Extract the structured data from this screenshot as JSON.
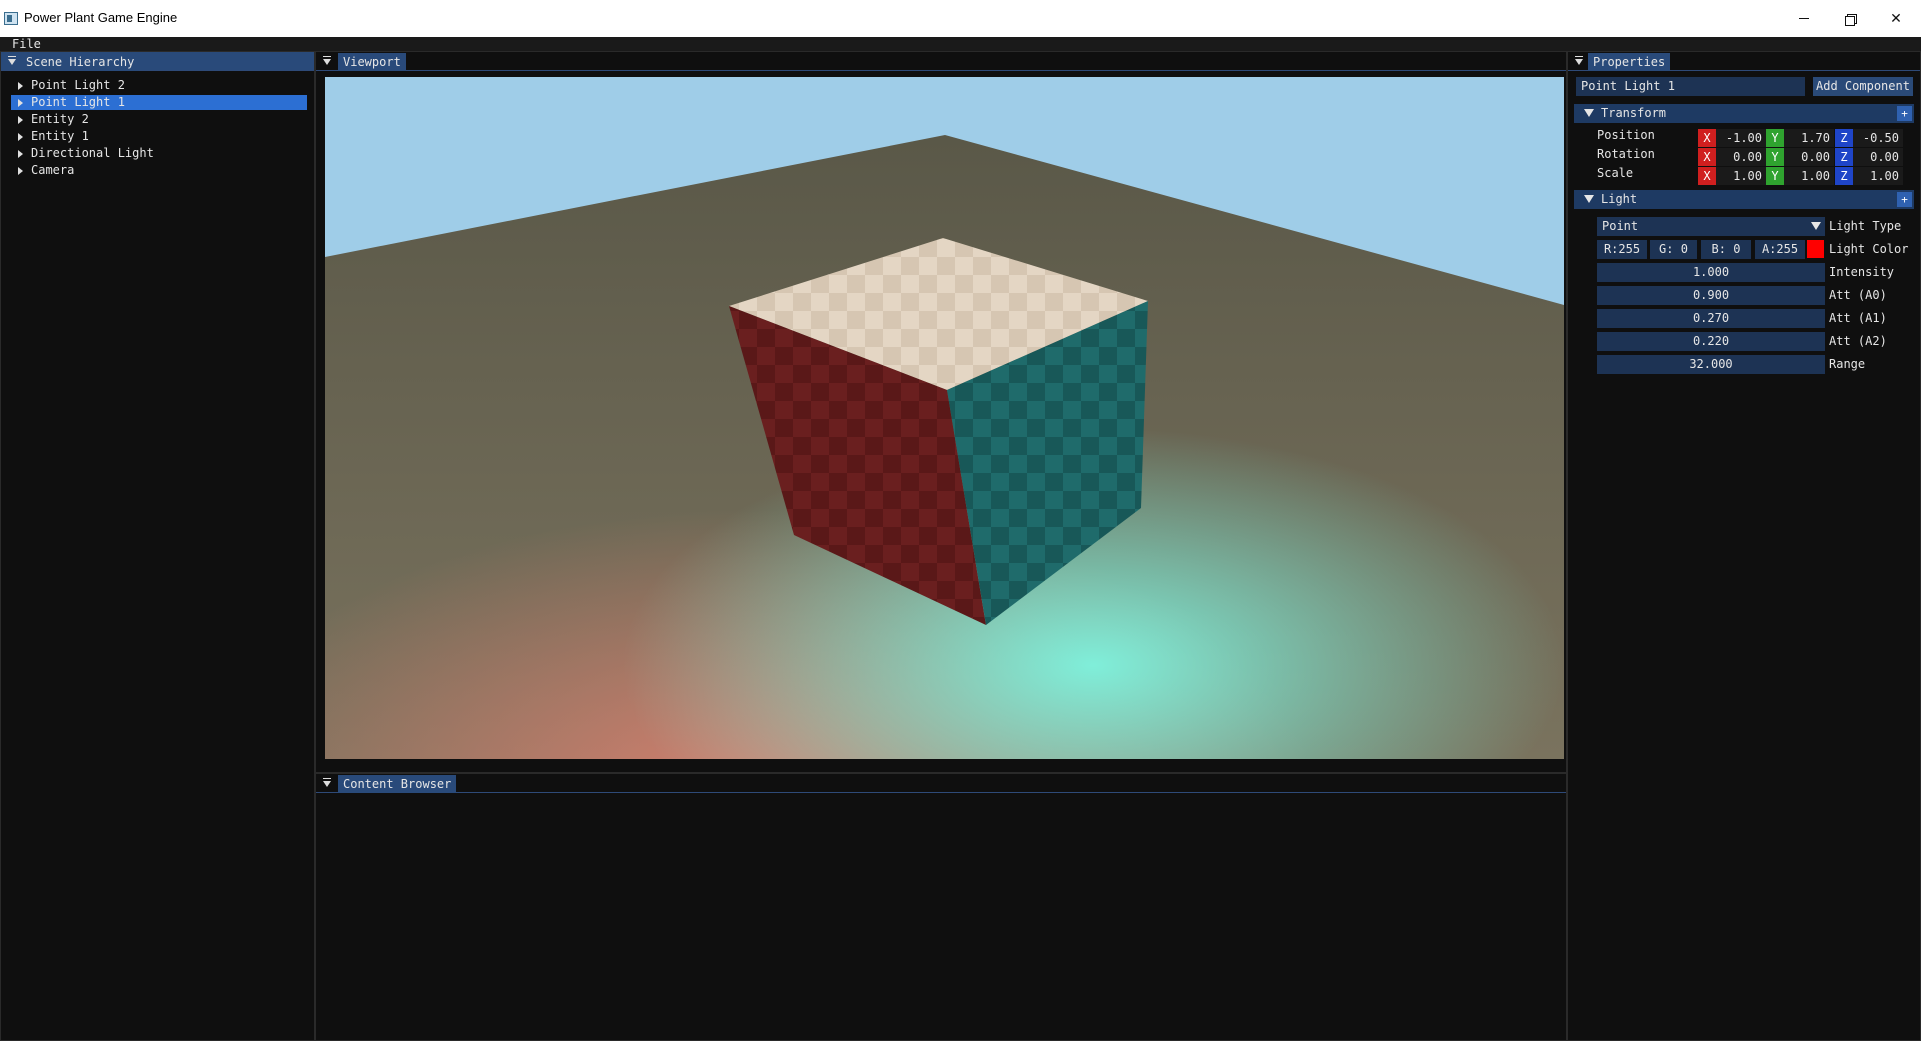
{
  "window": {
    "title": "Power Plant Game Engine"
  },
  "menu": {
    "file": "File"
  },
  "hierarchy": {
    "tab": "Scene Hierarchy",
    "items": [
      {
        "label": "Point Light 2",
        "selected": false
      },
      {
        "label": "Point Light 1",
        "selected": true
      },
      {
        "label": "Entity 2",
        "selected": false
      },
      {
        "label": "Entity 1",
        "selected": false
      },
      {
        "label": "Directional Light",
        "selected": false
      },
      {
        "label": "Camera",
        "selected": false
      }
    ]
  },
  "viewport": {
    "tab": "Viewport"
  },
  "content_browser": {
    "tab": "Content Browser"
  },
  "properties": {
    "tab": "Properties",
    "entity_name": "Point Light 1",
    "add_component": "Add Component",
    "transform": {
      "title": "Transform",
      "rows": [
        {
          "label": "Position",
          "x": "-1.00",
          "y": "1.70",
          "z": "-0.50"
        },
        {
          "label": "Rotation",
          "x": "0.00",
          "y": "0.00",
          "z": "0.00"
        },
        {
          "label": "Scale",
          "x": "1.00",
          "y": "1.00",
          "z": "1.00"
        }
      ],
      "axis_x": "X",
      "axis_y": "Y",
      "axis_z": "Z"
    },
    "light": {
      "title": "Light",
      "type_value": "Point",
      "type_label": "Light Type",
      "color": {
        "r": "R:255",
        "g": "G:  0",
        "b": "B:  0",
        "a": "A:255",
        "label": "Light Color",
        "swatch": "#ff0000"
      },
      "intensity": {
        "value": "1.000",
        "label": "Intensity"
      },
      "att0": {
        "value": "0.900",
        "label": "Att (A0)"
      },
      "att1": {
        "value": "0.270",
        "label": "Att (A1)"
      },
      "att2": {
        "value": "0.220",
        "label": "Att (A2)"
      },
      "range": {
        "value": "32.000",
        "label": "Range"
      }
    },
    "plus": "+"
  }
}
